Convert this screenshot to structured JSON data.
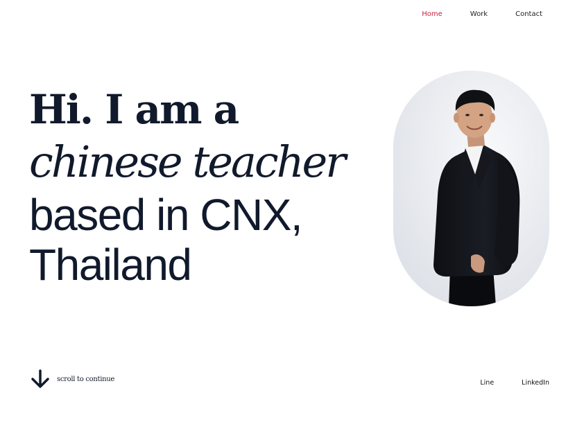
{
  "nav": {
    "home": "Home",
    "work": "Work",
    "contact": "Contact",
    "active_color": "#c81e3a"
  },
  "hero": {
    "line1": "Hi. I am a",
    "line2": "chinese teacher",
    "line3": "based in CNX,",
    "line4": "Thailand"
  },
  "portrait": {
    "icon": "person-portrait"
  },
  "scroll": {
    "icon": "arrow-down-icon",
    "label": "scroll to continue"
  },
  "social": {
    "line": "Line",
    "linkedin": "LinkedIn"
  },
  "colors": {
    "text": "#111a2c",
    "accent": "#c81e3a",
    "background": "#ffffff"
  }
}
